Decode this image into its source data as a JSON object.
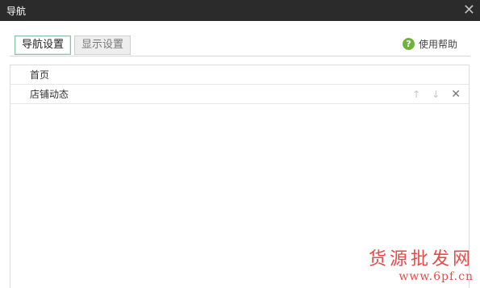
{
  "window": {
    "title": "导航",
    "close_icon": "close-icon"
  },
  "tabs": [
    {
      "label": "导航设置",
      "active": true
    },
    {
      "label": "显示设置",
      "active": false
    }
  ],
  "help": {
    "label": "使用帮助",
    "icon": "question-icon",
    "icon_glyph": "?"
  },
  "nav_items": [
    {
      "label": "首页",
      "has_actions": false
    },
    {
      "label": "店铺动态",
      "has_actions": true
    }
  ],
  "row_actions": {
    "up": "↑",
    "down": "↓",
    "delete": "✕"
  },
  "watermark": {
    "title": "货源批发网",
    "url": "www.6pf.cn"
  },
  "colors": {
    "titlebar": "#2b2b2b",
    "active_tab_border": "#8fc1a8",
    "help_icon": "#6fb43a",
    "watermark": "#e64a4a"
  }
}
